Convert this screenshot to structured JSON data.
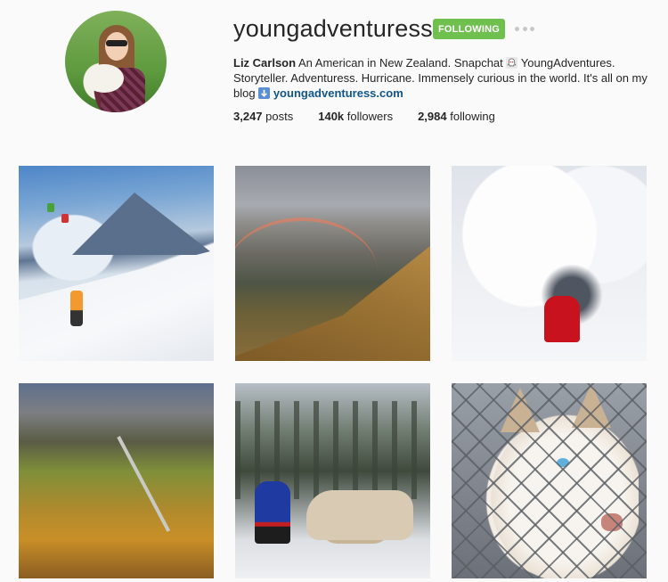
{
  "profile": {
    "username": "youngadventuress",
    "follow_label": "FOLLOWING",
    "more_icon": "ellipsis-icon",
    "full_name": "Liz Carlson",
    "bio_text_1": " An American in New Zealand. Snapchat ",
    "snapchat_icon": "ghost-icon",
    "bio_text_2": " YoungAdventures. Storyteller. Adventuress. Hurricane. Immensely curious in the world. It's all on my blog ",
    "arrow_icon": "arrow-down-icon",
    "website": "youngadventuress.com",
    "accent_color": "#70c050",
    "link_color": "#125688"
  },
  "stats": {
    "posts_count": "3,247",
    "posts_label": " posts",
    "followers_count": "140k",
    "followers_label": " followers",
    "following_count": "2,984",
    "following_label": " following"
  },
  "posts": [
    {
      "alt": "snowboarder on a snowy mountain slope with gondolas"
    },
    {
      "alt": "rainbow over mountain ridge"
    },
    {
      "alt": "person in red coat under snow-covered trees"
    },
    {
      "alt": "autumn valley with road"
    },
    {
      "alt": "person in blue cape with reindeer"
    },
    {
      "alt": "husky dog behind chain-link fence"
    }
  ]
}
